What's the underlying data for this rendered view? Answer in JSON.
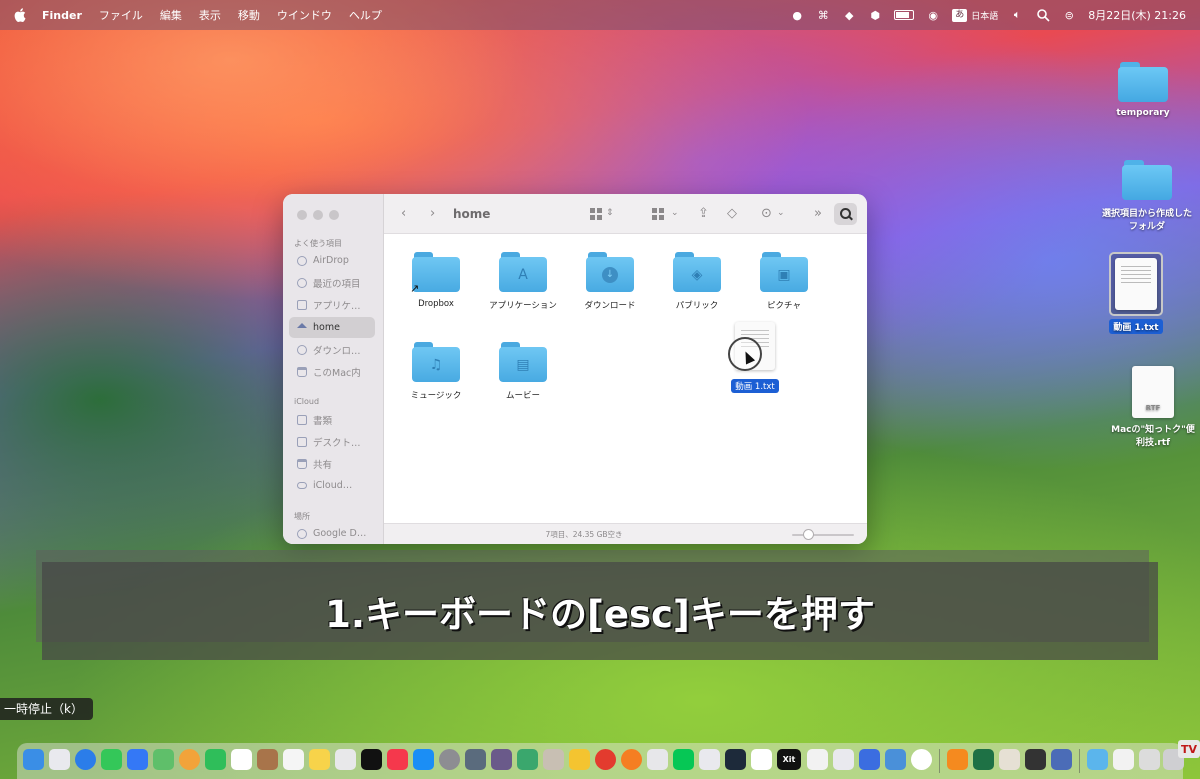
{
  "menubar": {
    "app_name": "Finder",
    "menus": [
      "ファイル",
      "編集",
      "表示",
      "移動",
      "ウインドウ",
      "ヘルプ"
    ],
    "ime_box": "あ",
    "ime_label": "日本語",
    "datetime": "8月22日(木) 21:26"
  },
  "desktop": {
    "items": [
      {
        "label": "temporary"
      },
      {
        "label": "選択項目から作成したフォルダ"
      },
      {
        "label": "動画 1.txt"
      },
      {
        "label": "Macの\"知っトク\"便利技.rtf",
        "ext": "RTF"
      }
    ]
  },
  "finder": {
    "title": "home",
    "sidebar": {
      "favorites_header": "よく使う項目",
      "favorites": [
        "AirDrop",
        "最近の項目",
        "アプリケ…",
        "home",
        "ダウンロ…",
        "このMac内"
      ],
      "icloud_header": "iCloud",
      "icloud": [
        "書類",
        "デスクト…",
        "共有",
        "iCloud…"
      ],
      "locations_header": "場所",
      "locations": [
        "Google D…"
      ]
    },
    "items": [
      "Dropbox",
      "アプリケーション",
      "ダウンロード",
      "パブリック",
      "ピクチャ",
      "ミュージック",
      "ムービー"
    ],
    "status": "7項目、24.35 GB空き",
    "icon_size_slider": 0.2
  },
  "dragged_file": {
    "label": "動画 1.txt"
  },
  "caption": {
    "text": "1.キーボードの[esc]キーを押す"
  },
  "tooltip": {
    "pause": "一時停止（k）"
  },
  "dock": {
    "xit_label": "Xit",
    "tv_label": "TV"
  },
  "colors": {
    "folder": "#48aae2",
    "selection": "#1c5fd4"
  }
}
